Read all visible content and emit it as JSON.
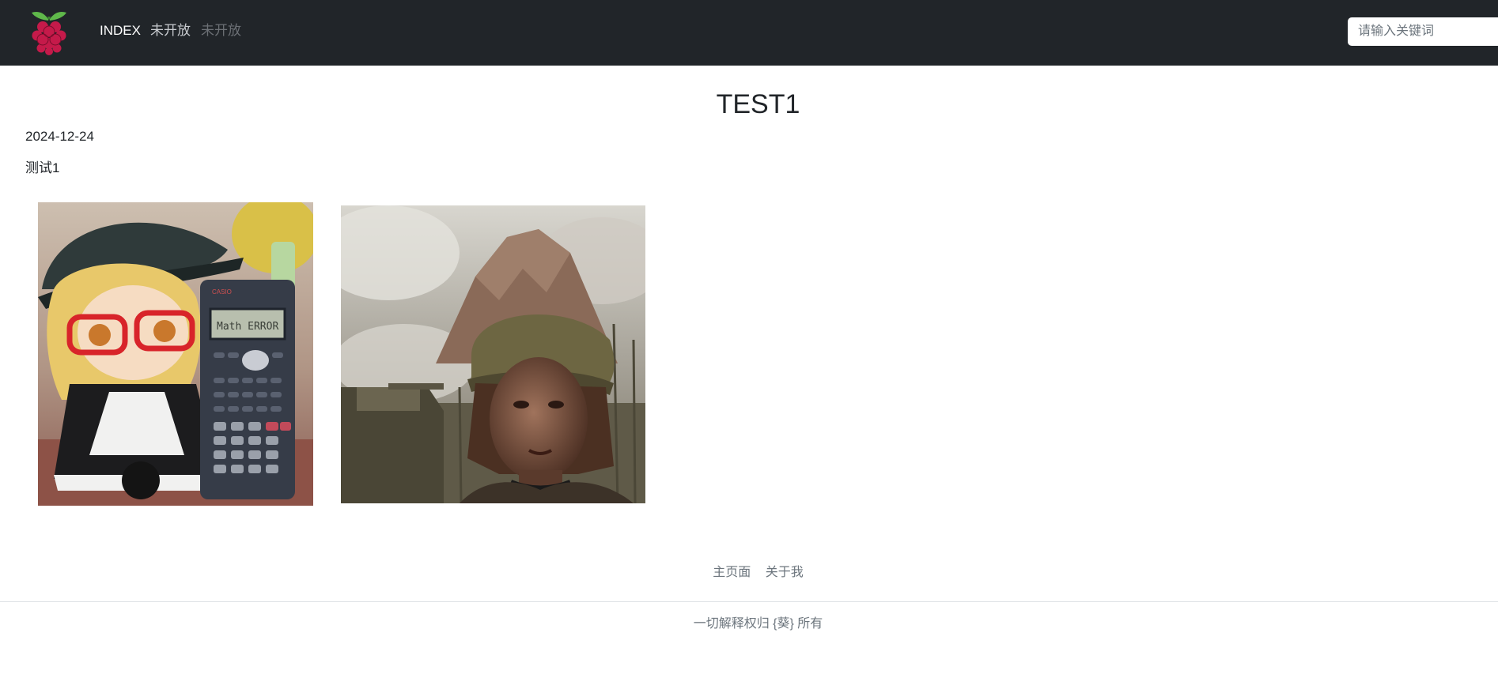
{
  "nav": {
    "logo_icon": "raspberry-pi-logo",
    "items": [
      {
        "label": "INDEX",
        "state": "active"
      },
      {
        "label": "未开放",
        "state": "normal"
      },
      {
        "label": "未开放",
        "state": "disabled"
      }
    ],
    "search_placeholder": "请输入关键词"
  },
  "post": {
    "title": "TEST1",
    "date": "2024-12-24",
    "content": "测试1",
    "images": [
      {
        "description": "plush doll with red glasses next to calculator showing Math ERROR"
      },
      {
        "description": "painting of soldier woman in helmet with tank and smoke"
      }
    ]
  },
  "footer": {
    "links": [
      "主页面",
      "关于我"
    ],
    "copyright": "一切解释权归 {葵} 所有"
  },
  "colors": {
    "navbar_bg": "#212529",
    "page_bg": "#ffffff",
    "muted_text": "#6c757d"
  }
}
